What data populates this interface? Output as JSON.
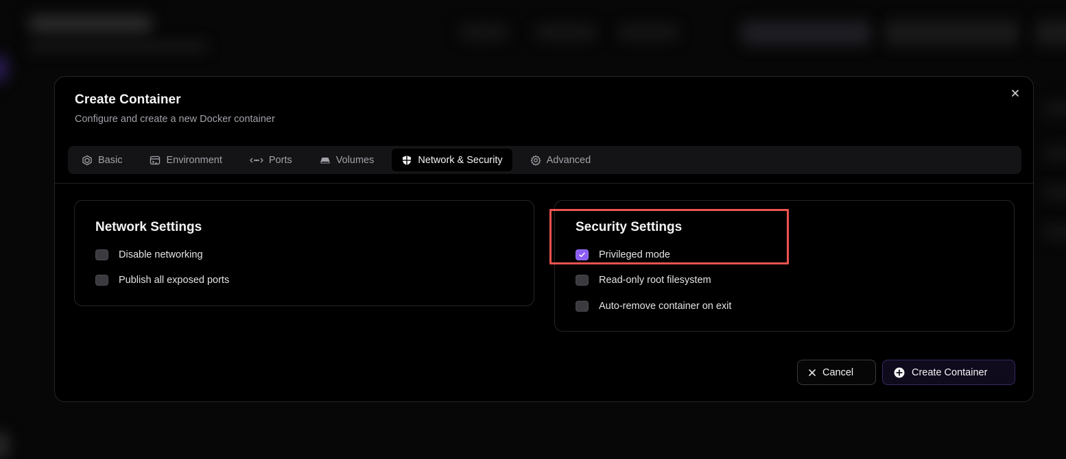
{
  "modal": {
    "title": "Create Container",
    "subtitle": "Configure and create a new Docker container",
    "close_icon": "close-icon"
  },
  "tabs": [
    {
      "label": "Basic",
      "icon": "cube-icon",
      "active": false
    },
    {
      "label": "Environment",
      "icon": "terminal-icon",
      "active": false
    },
    {
      "label": "Ports",
      "icon": "arrows-horizontal-icon",
      "active": false
    },
    {
      "label": "Volumes",
      "icon": "hard-drive-icon",
      "active": false
    },
    {
      "label": "Network & Security",
      "icon": "shield-icon",
      "active": true
    },
    {
      "label": "Advanced",
      "icon": "gear-icon",
      "active": false
    }
  ],
  "network": {
    "title": "Network Settings",
    "options": [
      {
        "label": "Disable networking",
        "checked": false
      },
      {
        "label": "Publish all exposed ports",
        "checked": false
      }
    ]
  },
  "security": {
    "title": "Security Settings",
    "options": [
      {
        "label": "Privileged mode",
        "checked": true
      },
      {
        "label": "Read-only root filesystem",
        "checked": false
      },
      {
        "label": "Auto-remove container on exit",
        "checked": false
      }
    ]
  },
  "footer": {
    "cancel_label": "Cancel",
    "create_label": "Create Container"
  },
  "colors": {
    "accent": "#8b5cf6",
    "highlight": "#ef5350"
  }
}
